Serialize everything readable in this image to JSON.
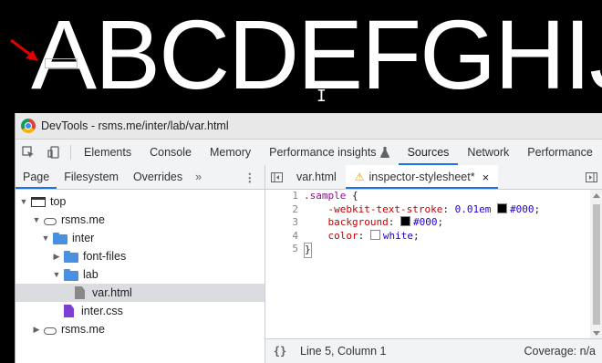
{
  "banner": {
    "big_text": "ABCDEFGHIJK",
    "cursor_glyph": "I"
  },
  "window": {
    "title": "DevTools - rsms.me/inter/lab/var.html"
  },
  "toolbar": {
    "inspect_icon": "inspect-element-icon",
    "device_icon": "device-toolbar-icon",
    "tabs": [
      {
        "label": "Elements"
      },
      {
        "label": "Console"
      },
      {
        "label": "Memory"
      },
      {
        "label": "Performance insights",
        "badge_icon": "flask-icon"
      },
      {
        "label": "Sources"
      },
      {
        "label": "Network"
      },
      {
        "label": "Performance"
      }
    ],
    "active_tab": "Sources"
  },
  "navigator": {
    "tabs": [
      {
        "label": "Page"
      },
      {
        "label": "Filesystem"
      },
      {
        "label": "Overrides"
      }
    ],
    "more": "»",
    "menu": "⋮",
    "tree": [
      {
        "label": "top"
      },
      {
        "label": "rsms.me"
      },
      {
        "label": "inter"
      },
      {
        "label": "font-files"
      },
      {
        "label": "lab"
      },
      {
        "label": "var.html"
      },
      {
        "label": "inter.css"
      },
      {
        "label": "rsms.me"
      }
    ]
  },
  "editor": {
    "tabs": [
      {
        "label": "var.html"
      },
      {
        "label": "inspector-stylesheet*",
        "close": "×"
      }
    ],
    "lines": {
      "n1": "1",
      "n2": "2",
      "n3": "3",
      "n4": "4",
      "n5": "5",
      "selector": ".sample",
      "brace_open": " {",
      "prop1": "-webkit-text-stroke",
      "prop1_num": "0.01em",
      "prop1_color": "#000",
      "prop2": "background",
      "prop2_color": "#000",
      "prop3": "color",
      "prop3_color": "white",
      "brace_close": "}"
    },
    "swatch_colors": {
      "black": "#000000",
      "white": "#ffffff"
    }
  },
  "statusbar": {
    "pretty_print": "{}",
    "position": "Line 5, Column 1",
    "coverage": "Coverage: n/a"
  },
  "colors": {
    "accent": "#1a73e8",
    "warning": "#f29900",
    "folder": "#4a90e2"
  }
}
